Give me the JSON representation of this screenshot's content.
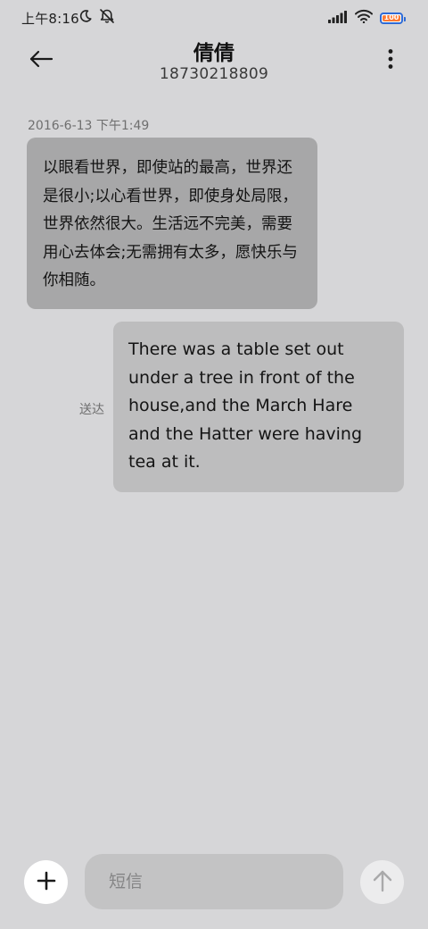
{
  "status_bar": {
    "time": "上午8:16",
    "battery_level": "100",
    "icons": [
      "moon-icon",
      "mute-bell-icon",
      "signal-icon",
      "wifi-icon",
      "battery-icon"
    ]
  },
  "header": {
    "contact_name": "倩倩",
    "contact_number": "18730218809",
    "icons": [
      "back-arrow-icon",
      "more-vertical-icon"
    ]
  },
  "conversation": {
    "timestamp": "2016-6-13 下午1:49",
    "messages": [
      {
        "direction": "incoming",
        "text": "以眼看世界，即使站的最高，世界还是很小;以心看世界，即使身处局限，世界依然很大。生活远不完美，需要用心去体会;无需拥有太多，愿快乐与你相随。"
      },
      {
        "direction": "outgoing",
        "text": "There was a table set out under a tree in front of the house,and the March Hare and the Hatter were having tea at it.",
        "status": "送达"
      }
    ]
  },
  "composer": {
    "placeholder": "短信",
    "value": "",
    "icons": [
      "plus-icon",
      "send-arrow-icon"
    ]
  },
  "colors": {
    "background": "#d6d6d8",
    "incoming_bubble": "#a7a7a8",
    "outgoing_bubble": "#bdbdbe",
    "battery_fill": "#ff7a33",
    "battery_outline": "#2e6bd6"
  }
}
